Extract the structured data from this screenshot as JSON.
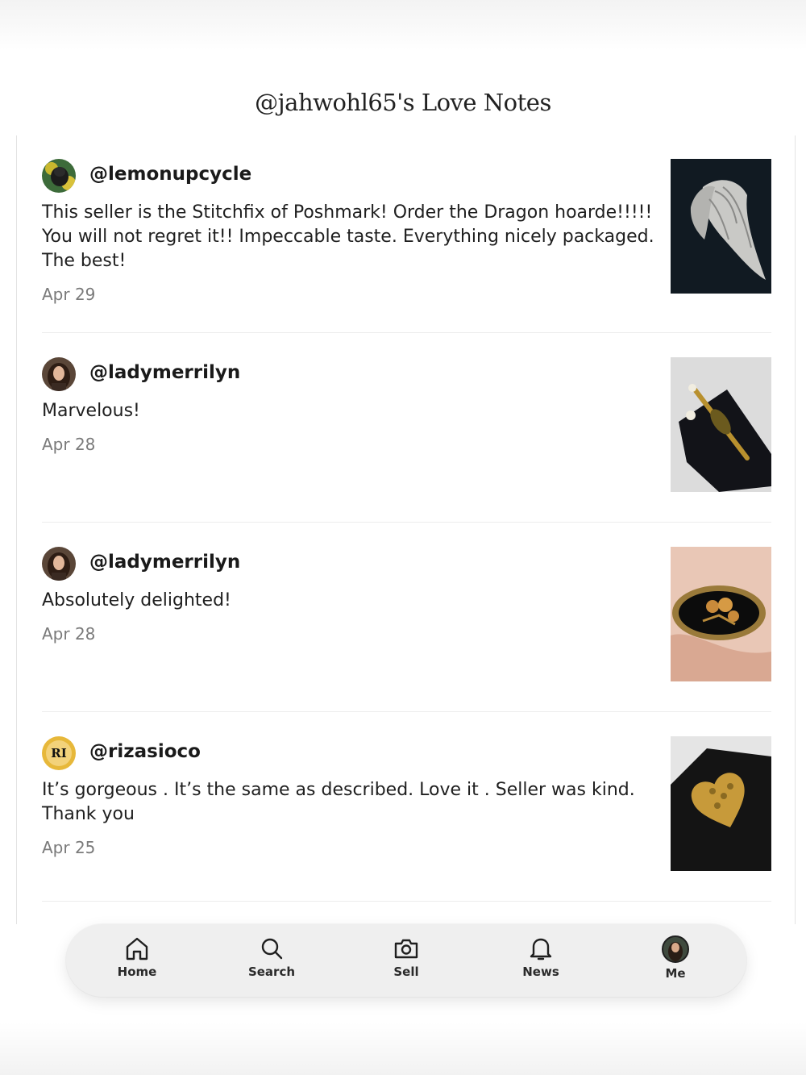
{
  "page": {
    "title": "@jahwohl65's Love Notes"
  },
  "notes": [
    {
      "username": "@lemonupcycle",
      "comment": "This seller is the Stitchfix of Poshmark! Order the Dragon hoarde!!!!! You will not regret it!! Impeccable taste. Everything nicely packaged. The best!",
      "date": "Apr 29",
      "avatar_icon": "dog-photo-avatar",
      "thumb_icon": "silver-feather-brooch-image"
    },
    {
      "username": "@ladymerrilyn",
      "comment": "Marvelous!",
      "date": "Apr 28",
      "avatar_icon": "woman-photo-avatar",
      "thumb_icon": "gold-pin-brooch-image"
    },
    {
      "username": "@ladymerrilyn",
      "comment": "Absolutely delighted!",
      "date": "Apr 28",
      "avatar_icon": "woman-photo-avatar",
      "thumb_icon": "rose-oval-brooch-image"
    },
    {
      "username": "@rizasioco",
      "comment": "It’s gorgeous . It’s the same as described. Love it . Seller was kind. Thank you",
      "date": "Apr 25",
      "avatar_icon": "ri-logo-avatar",
      "thumb_icon": "gold-heart-pendant-image"
    }
  ],
  "nav": {
    "items": [
      {
        "label": "Home",
        "icon": "home-icon"
      },
      {
        "label": "Search",
        "icon": "search-icon"
      },
      {
        "label": "Sell",
        "icon": "camera-icon"
      },
      {
        "label": "News",
        "icon": "bell-icon"
      },
      {
        "label": "Me",
        "icon": "profile-avatar-icon"
      }
    ]
  },
  "colors": {
    "text": "#1a1a1a",
    "muted": "#7a7a7a",
    "nav_background": "#efefef",
    "divider": "#ececec"
  }
}
